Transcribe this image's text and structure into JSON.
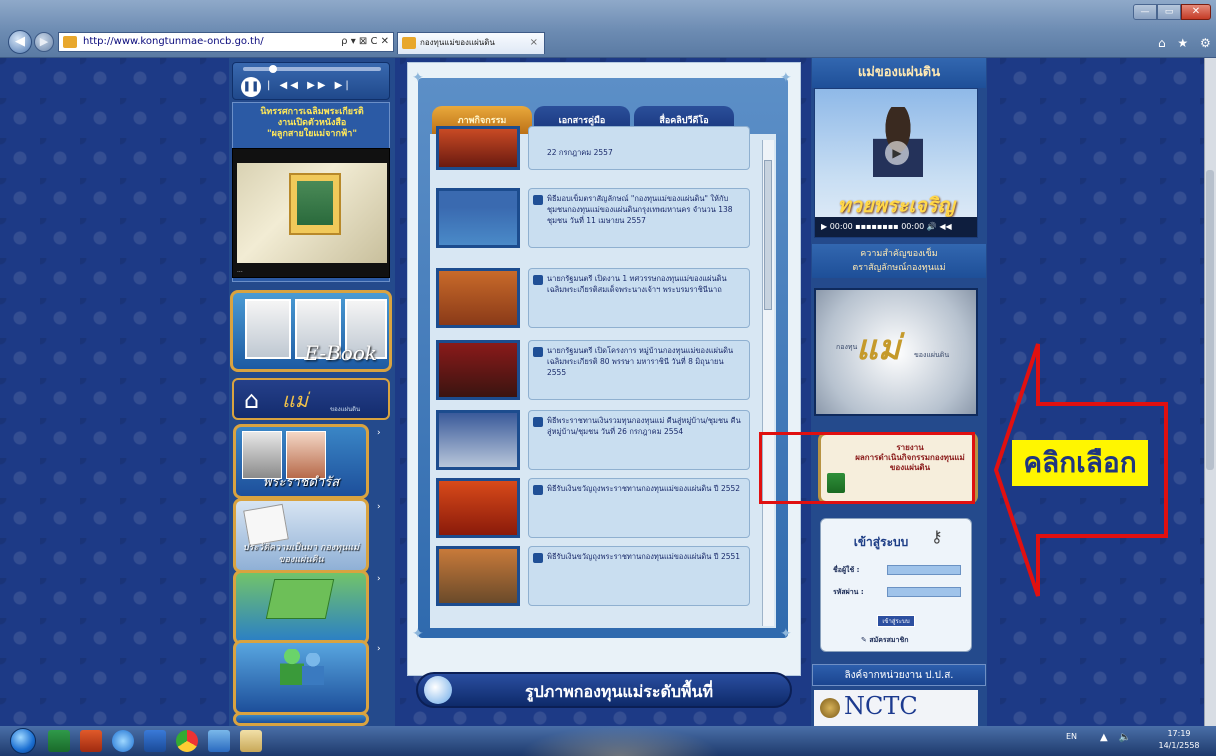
{
  "browser": {
    "url": "http://www.kongtunmae-oncb.go.th/",
    "address_controls": "ρ ▾ ⊠ C ✕",
    "tab_title": "กองทุนแม่ของแผ่นดิน",
    "tab_close": "×",
    "nav_back": "◀",
    "nav_forward": "▶",
    "toolbar_icons": "⌂ ★ ⚙",
    "window_min": "—",
    "window_max": "▭",
    "window_close": "✕"
  },
  "left_sidebar": {
    "player_controls": "| ◀◀ ▶▶ ▶|",
    "player_pause": "❚❚",
    "promo_title": "นิทรรศการเฉลิมพระเกียรติ\nงานเปิดตัวหนังสือ\n\"ผลูกสายใยแม่จากฟ้า\"",
    "promo_caption": "...",
    "ebook_label": "E-Book",
    "home_logo": "แม่",
    "home_logo_sub": "ของแผ่นดิน",
    "buttons": [
      {
        "label": "พระราชดำรัส"
      },
      {
        "label": "ประวัติความเป็นมา กองทุนแม่ของแผ่นดิน"
      },
      {
        "label": ""
      },
      {
        "label": ""
      },
      {
        "label": ""
      }
    ]
  },
  "center": {
    "tabs": [
      {
        "label": "ภาพกิจกรรม"
      },
      {
        "label": "เอกสารคู่มือ"
      },
      {
        "label": "สื่อคลิปวีดีโอ"
      }
    ],
    "news": [
      {
        "text": "22 กรกฎาคม 2557"
      },
      {
        "text": "พิธีมอบเข็มตราสัญลักษณ์ \"กองทุนแม่ของแผ่นดิน\" ให้กับชุมชนกองทุนแม่ของแผ่นดินกรุงเทพมหานคร จำนวน 138 ชุมชน วันที่ 11 เมษายน 2557"
      },
      {
        "text": "นายกรัฐมนตรี เปิดงาน 1 ทศวรรษกองทุนแม่ของแผ่นดิน เฉลิมพระเกียรติสมเด็จพระนางเจ้าฯ พระบรมราชินีนาถ"
      },
      {
        "text": "นายกรัฐมนตรี เปิดโครงการ หมู่บ้านกองทุนแม่ของแผ่นดิน เฉลิมพระเกียรติ 80 พรรษา มหาราชินี วันที่ 8 มิถุนายน 2555"
      },
      {
        "text": "พิธีพระราชทานเงินรวมทุนกองทุนแม่ คืนสู่หมู่บ้าน/ชุมชน คืนสู่หมู่บ้าน/ชุมชน วันที่ 26 กรกฎาคม 2554"
      },
      {
        "text": "พิธีรับเงินขวัญถุงพระราชทานกองทุนแม่ของแผ่นดิน ปี 2552"
      },
      {
        "text": "พิธีรับเงินขวัญถุงพระราชทานกองทุนแม่ของแผ่นดิน ปี 2551"
      }
    ],
    "gallery_label": "รูปภาพกองทุนแม่ระดับพื้นที่"
  },
  "right_sidebar": {
    "mother_title": "แม่ของแผ่นดิน",
    "mother_caption": "ทวยพระเจริญ",
    "mother_play": "▶",
    "mother_controls": "▶ 00:00 ▪▪▪▪▪▪▪▪ 00:00 🔊 ◀◀",
    "importance_title": "ความสำคัญของเข็ม\nตราสัญลักษณ์กองทุนแม่",
    "logo_pre": "กองทุน",
    "logo_mark": "แม่",
    "logo_post": "ของแผ่นดิน",
    "report_text": "รายงาน\nผลการดำเนินกิจกรรมกองทุนแม่\nของแผ่นดิน",
    "login_title": "เข้าสู่ระบบ",
    "login_user_label": "ชื่อผู้ใช้ :",
    "login_pass_label": "รหัสผ่าน :",
    "login_submit": "เข้าสู่ระบบ",
    "login_register": "สมัครสมาชิก",
    "agency_title": "ลิงค์จากหน่วยงาน ป.ป.ส.",
    "agency_logo": "NCTC"
  },
  "annotation": {
    "label": "คลิกเลือก",
    "color": "#e01010",
    "label_bg": "#fff600"
  },
  "taskbar": {
    "lang": "EN",
    "tray_icons": "▲ 🔈",
    "clock_time": "17:19",
    "clock_date": "14/1/2558"
  }
}
